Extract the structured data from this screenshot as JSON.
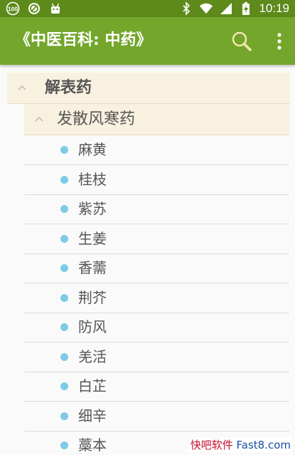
{
  "status_bar": {
    "time": "10:19",
    "left_icons": [
      "battery-100-icon",
      "blocked-icon",
      "android-icon"
    ],
    "right_icons": [
      "bluetooth-icon",
      "wifi-icon",
      "signal-icon",
      "battery-charging-icon"
    ]
  },
  "app_bar": {
    "title": "《中医百科: 中药》",
    "actions": [
      "search-icon",
      "more-vert-icon"
    ]
  },
  "tree": {
    "group": "解表药",
    "subgroup": "发散风寒药",
    "items": [
      "麻黄",
      "桂枝",
      "紫苏",
      "生姜",
      "香薷",
      "荆芥",
      "防风",
      "羌活",
      "白芷",
      "细辛",
      "藁本"
    ]
  },
  "watermark": {
    "part1": "快吧软件",
    "part2": " Fast8.com"
  },
  "colors": {
    "status_bar": "#5d8a1a",
    "app_bar": "#73a62b",
    "group_bg": "#f8f1df",
    "dot": "#7ecbe6"
  }
}
